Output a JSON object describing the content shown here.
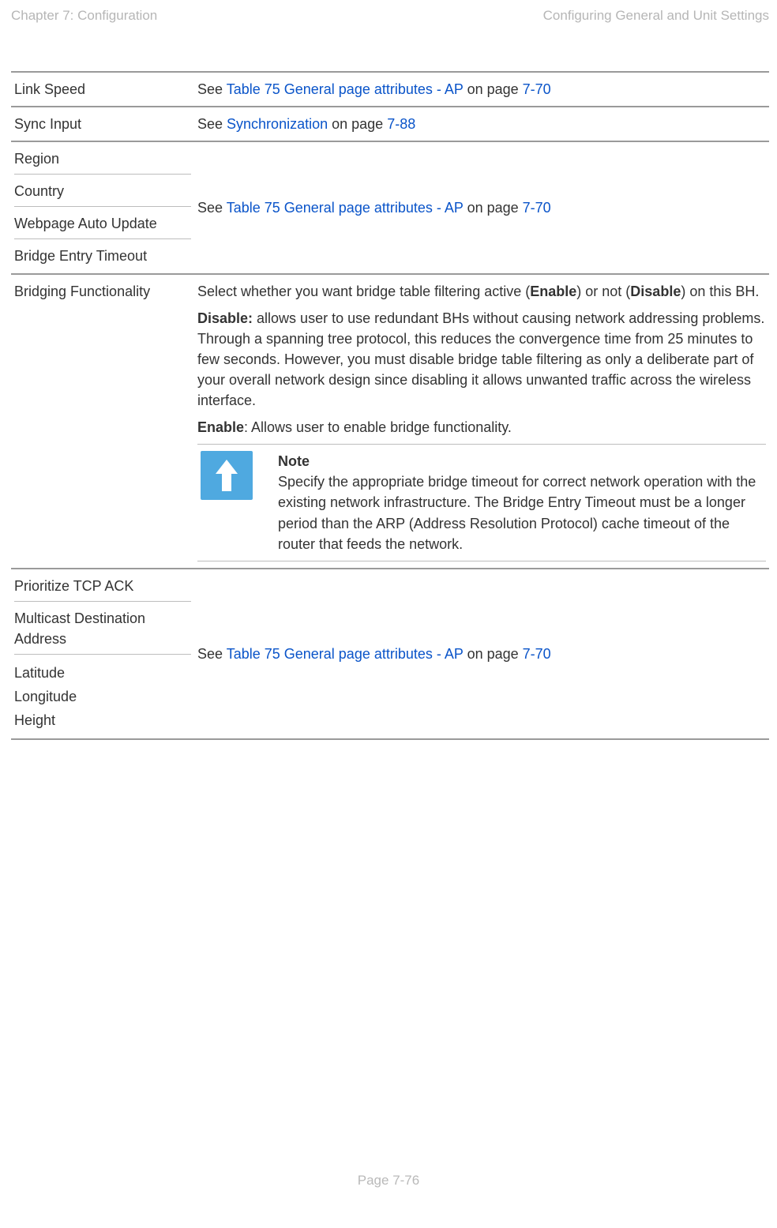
{
  "header": {
    "left": "Chapter 7:  Configuration",
    "right": "Configuring General and Unit Settings"
  },
  "footer": "Page 7-76",
  "cross_ref": {
    "see_prefix": "See ",
    "table75_link": "Table 75 General page attributes - AP",
    "on_page": " on page ",
    "page_7_70": "7-70",
    "sync_link": "Synchronization",
    "page_7_88": "7-88"
  },
  "rows": {
    "link_speed": {
      "label": "Link Speed"
    },
    "sync_input": {
      "label": "Sync Input"
    },
    "group1": {
      "region": "Region",
      "country": "Country",
      "webpage_auto_update": "Webpage Auto Update",
      "bridge_entry_timeout": "Bridge Entry Timeout"
    },
    "bridging": {
      "label": "Bridging Functionality",
      "intro_1": "Select whether you want bridge table filtering active (",
      "enable_word": "Enable",
      "intro_2": ") or not (",
      "disable_word": "Disable",
      "intro_3": ") on this BH.",
      "disable_label": "Disable:",
      "disable_text": " allows user to use redundant BHs without causing network addressing problems. Through a spanning tree protocol, this reduces the convergence time from 25 minutes to few seconds. However, you must disable bridge table filtering as only a deliberate part of your overall network design since disabling it allows unwanted traffic across the wireless interface.",
      "enable_label": "Enable",
      "enable_text": ": Allows user to enable bridge functionality.",
      "note_title": "Note",
      "note_body": "Specify the appropriate bridge timeout for correct network operation with the existing network infrastructure. The Bridge Entry Timeout must be a longer period than the ARP (Address Resolution Protocol) cache timeout of the router that feeds the network."
    },
    "group2": {
      "prioritize_tcp_ack": "Prioritize TCP ACK",
      "multicast_dest_addr": "Multicast Destination Address",
      "latitude": "Latitude",
      "longitude": "Longitude",
      "height": "Height"
    }
  }
}
